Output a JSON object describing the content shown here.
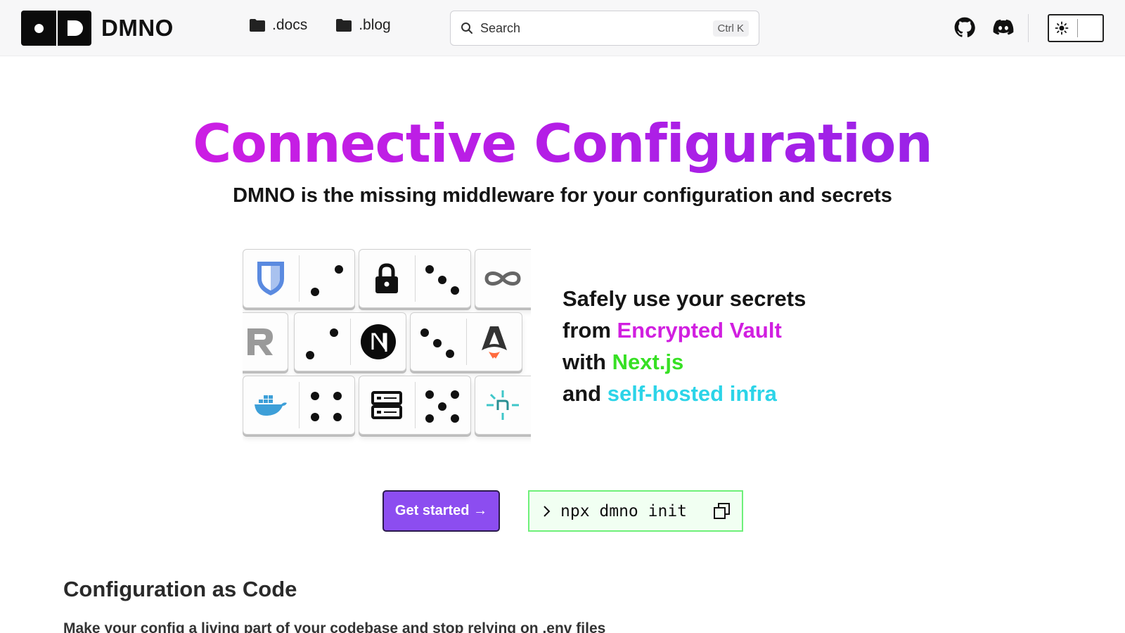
{
  "header": {
    "logo_text": "DMNO",
    "nav": [
      {
        "label": ".docs",
        "icon": "folder-icon"
      },
      {
        "label": ".blog",
        "icon": "folder-icon"
      }
    ],
    "search": {
      "placeholder": "Search",
      "shortcut": "Ctrl K"
    },
    "icons": [
      "github-icon",
      "discord-icon",
      "sun-icon"
    ]
  },
  "hero": {
    "title": "Connective Configuration",
    "subtitle": "DMNO is the missing middleware for your configuration and secrets",
    "lines": [
      {
        "prefix": "Safely use your secrets",
        "highlight": ""
      },
      {
        "prefix": "from ",
        "highlight": "Encrypted Vault"
      },
      {
        "prefix": "with ",
        "highlight": "Next.js"
      },
      {
        "prefix": "and ",
        "highlight": "self-hosted infra"
      }
    ],
    "tile_icons": [
      "bitwarden-icon",
      "lock-icon",
      "infinity-icon",
      "railway-icon",
      "nextjs-icon",
      "astro-icon",
      "docker-icon",
      "server-icon",
      "netlify-icon"
    ],
    "colors": {
      "title_start": "#d91de2",
      "title_end": "#8d25e8",
      "vault": "#d11fe0",
      "nextjs": "#37e024",
      "infra": "#2cd4e8"
    }
  },
  "cta": {
    "primary_label": "Get started →",
    "command": "npx dmno init",
    "copy_icon": "copy-icon"
  },
  "section": {
    "title": "Configuration as Code",
    "text": "Make your config a living part of your codebase and stop relying on .env files"
  }
}
